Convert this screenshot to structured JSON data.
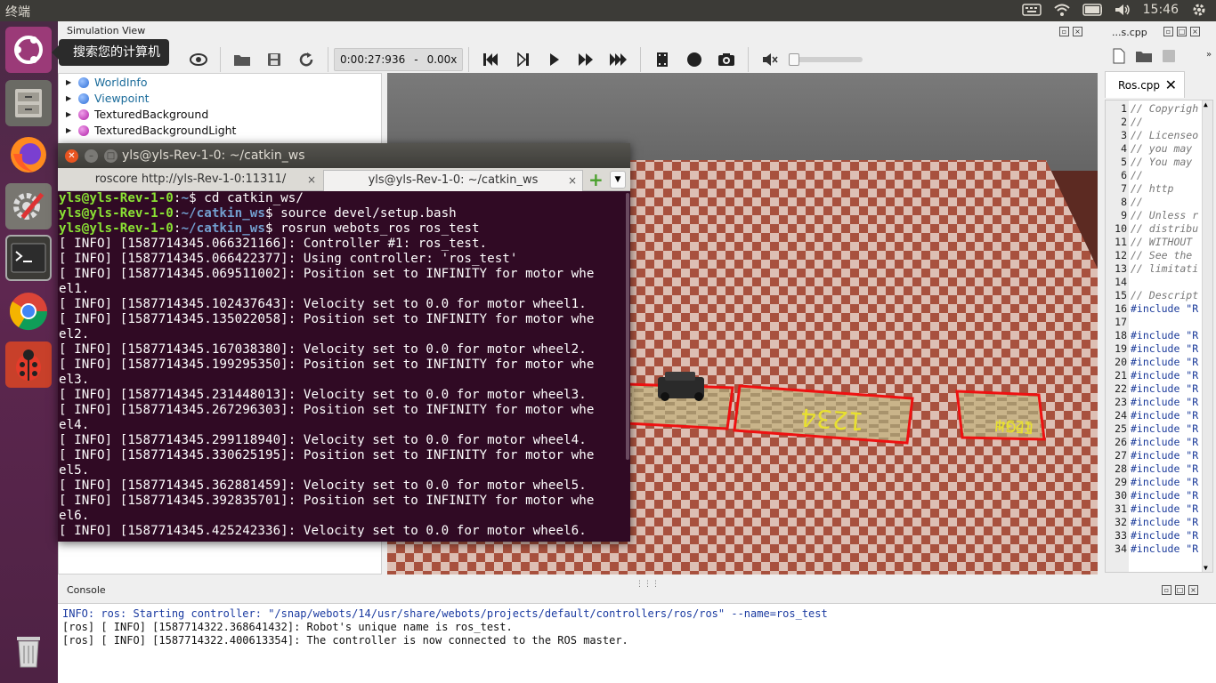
{
  "top_panel": {
    "app_title": "终端",
    "time": "15:46"
  },
  "launcher": {
    "tooltip": "搜索您的计算机"
  },
  "webots": {
    "sim_view_title": "Simulation View",
    "time_display": "0:00:27:936",
    "time_separator": "-",
    "speed": "0.00x",
    "scene_tree": [
      {
        "label": "WorldInfo",
        "color": "#2f6fd6",
        "text_color": "#1a6b9a"
      },
      {
        "label": "Viewpoint",
        "color": "#2f6fd6",
        "text_color": "#1a6b9a"
      },
      {
        "label": "TexturedBackground",
        "color": "#b01fa8",
        "text_color": "#111111"
      },
      {
        "label": "TexturedBackgroundLight",
        "color": "#b01fa8",
        "text_color": "#111111"
      }
    ],
    "editor": {
      "header_title": "...s.cpp",
      "tab_label": "Ros.cpp",
      "lines": [
        {
          "n": "1",
          "t": "// Copyrigh",
          "inc": false
        },
        {
          "n": "2",
          "t": "//",
          "inc": false
        },
        {
          "n": "3",
          "t": "// Licenseo",
          "inc": false
        },
        {
          "n": "4",
          "t": "// you may",
          "inc": false
        },
        {
          "n": "5",
          "t": "// You may",
          "inc": false
        },
        {
          "n": "6",
          "t": "//",
          "inc": false
        },
        {
          "n": "7",
          "t": "//     http",
          "inc": false
        },
        {
          "n": "8",
          "t": "//",
          "inc": false
        },
        {
          "n": "9",
          "t": "// Unless r",
          "inc": false
        },
        {
          "n": "10",
          "t": "// distribu",
          "inc": false
        },
        {
          "n": "11",
          "t": "// WITHOUT",
          "inc": false
        },
        {
          "n": "12",
          "t": "// See the",
          "inc": false
        },
        {
          "n": "13",
          "t": "// limitati",
          "inc": false
        },
        {
          "n": "14",
          "t": "",
          "inc": false
        },
        {
          "n": "15",
          "t": "// Descript",
          "inc": false
        },
        {
          "n": "16",
          "t": "#include \"R",
          "inc": true
        },
        {
          "n": "17",
          "t": "",
          "inc": false
        },
        {
          "n": "18",
          "t": "#include \"R",
          "inc": true
        },
        {
          "n": "19",
          "t": "#include \"R",
          "inc": true
        },
        {
          "n": "20",
          "t": "#include \"R",
          "inc": true
        },
        {
          "n": "21",
          "t": "#include \"R",
          "inc": true
        },
        {
          "n": "22",
          "t": "#include \"R",
          "inc": true
        },
        {
          "n": "23",
          "t": "#include \"R",
          "inc": true
        },
        {
          "n": "24",
          "t": "#include \"R",
          "inc": true
        },
        {
          "n": "25",
          "t": "#include \"R",
          "inc": true
        },
        {
          "n": "26",
          "t": "#include \"R",
          "inc": true
        },
        {
          "n": "27",
          "t": "#include \"R",
          "inc": true
        },
        {
          "n": "28",
          "t": "#include \"R",
          "inc": true
        },
        {
          "n": "29",
          "t": "#include \"R",
          "inc": true
        },
        {
          "n": "30",
          "t": "#include \"R",
          "inc": true
        },
        {
          "n": "31",
          "t": "#include \"R",
          "inc": true
        },
        {
          "n": "32",
          "t": "#include \"R",
          "inc": true
        },
        {
          "n": "33",
          "t": "#include \"R",
          "inc": true
        },
        {
          "n": "34",
          "t": "#include \"R",
          "inc": true
        }
      ]
    },
    "scene_3d": {
      "sign_text": "1234",
      "sign2_text": "EFGH",
      "sign3_text": "1234"
    },
    "console": {
      "title": "Console",
      "lines": [
        {
          "text": "INFO: ros: Starting controller: \"/snap/webots/14/usr/share/webots/projects/default/controllers/ros/ros\" --name=ros_test",
          "info": true
        },
        {
          "text": "[ros] [ INFO] [1587714322.368641432]: Robot's unique name is ros_test.",
          "info": false
        },
        {
          "text": "[ros] [ INFO] [1587714322.400613354]: The controller is now connected to the ROS master.",
          "info": false
        }
      ]
    }
  },
  "terminal": {
    "title": "yls@yls-Rev-1-0: ~/catkin_ws",
    "tabs": [
      {
        "label": "roscore http://yls-Rev-1-0:11311/"
      },
      {
        "label": "yls@yls-Rev-1-0: ~/catkin_ws"
      }
    ],
    "prompt_user": "yls@yls-Rev-1-0",
    "commands": [
      {
        "path": "~",
        "cmd": "$ cd catkin_ws/"
      },
      {
        "path": "~/catkin_ws",
        "cmd": "$ source devel/setup.bash"
      },
      {
        "path": "~/catkin_ws",
        "cmd": "$ rosrun webots_ros ros_test"
      }
    ],
    "output": [
      "[ INFO] [1587714345.066321166]: Controller #1: ros_test.",
      "[ INFO] [1587714345.066422377]: Using controller: 'ros_test'",
      "[ INFO] [1587714345.069511002]: Position set to INFINITY for motor whe",
      "el1.",
      "[ INFO] [1587714345.102437643]: Velocity set to 0.0 for motor wheel1.",
      "[ INFO] [1587714345.135022058]: Position set to INFINITY for motor whe",
      "el2.",
      "[ INFO] [1587714345.167038380]: Velocity set to 0.0 for motor wheel2.",
      "[ INFO] [1587714345.199295350]: Position set to INFINITY for motor whe",
      "el3.",
      "[ INFO] [1587714345.231448013]: Velocity set to 0.0 for motor wheel3.",
      "[ INFO] [1587714345.267296303]: Position set to INFINITY for motor whe",
      "el4.",
      "[ INFO] [1587714345.299118940]: Velocity set to 0.0 for motor wheel4.",
      "[ INFO] [1587714345.330625195]: Position set to INFINITY for motor whe",
      "el5.",
      "[ INFO] [1587714345.362881459]: Velocity set to 0.0 for motor wheel5.",
      "[ INFO] [1587714345.392835701]: Position set to INFINITY for motor whe",
      "el6.",
      "[ INFO] [1587714345.425242336]: Velocity set to 0.0 for motor wheel6."
    ]
  }
}
